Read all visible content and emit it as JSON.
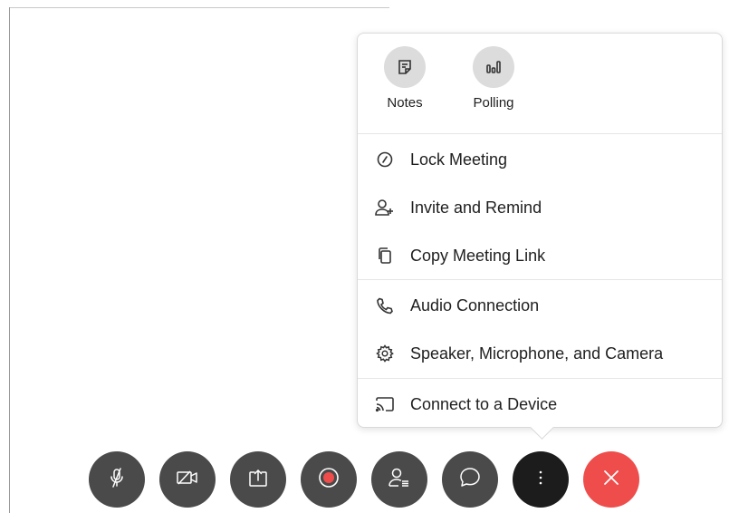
{
  "popover": {
    "quick_actions": [
      {
        "label": "Notes",
        "icon": "notes-icon"
      },
      {
        "label": "Polling",
        "icon": "polling-icon"
      }
    ],
    "items": [
      {
        "label": "Lock Meeting",
        "icon": "lock-icon"
      },
      {
        "label": "Invite and Remind",
        "icon": "add-person-icon"
      },
      {
        "label": "Copy Meeting Link",
        "icon": "copy-icon"
      },
      {
        "label": "Audio Connection",
        "icon": "phone-icon"
      },
      {
        "label": "Speaker, Microphone, and Camera",
        "icon": "gear-icon"
      },
      {
        "label": "Connect to a Device",
        "icon": "cast-icon"
      }
    ]
  },
  "toolbar": [
    {
      "name": "mute-button",
      "icon": "microphone-muted-icon"
    },
    {
      "name": "video-button",
      "icon": "video-off-icon"
    },
    {
      "name": "share-button",
      "icon": "share-icon"
    },
    {
      "name": "record-button",
      "icon": "record-icon"
    },
    {
      "name": "participants-button",
      "icon": "participants-icon"
    },
    {
      "name": "chat-button",
      "icon": "chat-icon"
    },
    {
      "name": "more-options-button",
      "icon": "more-icon",
      "state": "active"
    },
    {
      "name": "leave-button",
      "icon": "close-icon"
    }
  ],
  "colors": {
    "toolbar_button": "#4a4a4a",
    "active_button": "#1c1c1c",
    "leave_button": "#ee4d4b",
    "record_dot": "#ee4d4b"
  }
}
